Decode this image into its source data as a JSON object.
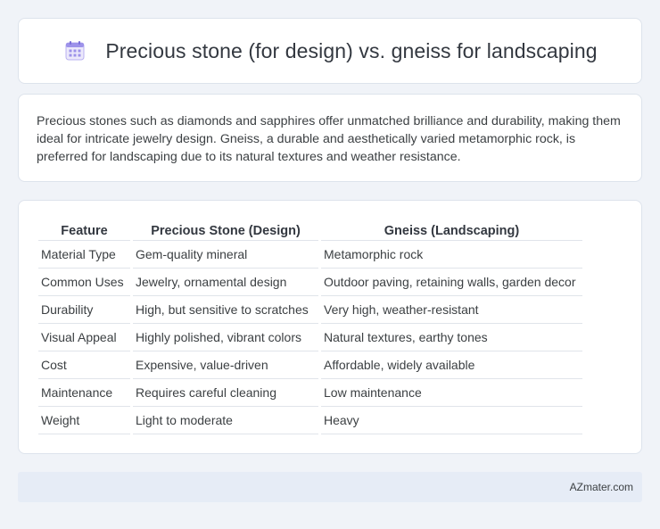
{
  "header": {
    "title": "Precious stone (for design) vs. gneiss for landscaping",
    "icon": "calendar-icon"
  },
  "intro": {
    "text": "Precious stones such as diamonds and sapphires offer unmatched brilliance and durability, making them ideal for intricate jewelry design. Gneiss, a durable and aesthetically varied metamorphic rock, is preferred for landscaping due to its natural textures and weather resistance."
  },
  "table": {
    "headers": [
      "Feature",
      "Precious Stone (Design)",
      "Gneiss (Landscaping)"
    ],
    "rows": [
      [
        "Material Type",
        "Gem-quality mineral",
        "Metamorphic rock"
      ],
      [
        "Common Uses",
        "Jewelry, ornamental design",
        "Outdoor paving, retaining walls, garden decor"
      ],
      [
        "Durability",
        "High, but sensitive to scratches",
        "Very high, weather-resistant"
      ],
      [
        "Visual Appeal",
        "Highly polished, vibrant colors",
        "Natural textures, earthy tones"
      ],
      [
        "Cost",
        "Expensive, value-driven",
        "Affordable, widely available"
      ],
      [
        "Maintenance",
        "Requires careful cleaning",
        "Low maintenance"
      ],
      [
        "Weight",
        "Light to moderate",
        "Heavy"
      ]
    ]
  },
  "footer": {
    "site": "AZmater.com"
  },
  "colors": {
    "page_background": "#f0f3f8",
    "card_background": "#ffffff",
    "footer_background": "#e6ecf6",
    "icon_accent": "#8a7fe0"
  }
}
